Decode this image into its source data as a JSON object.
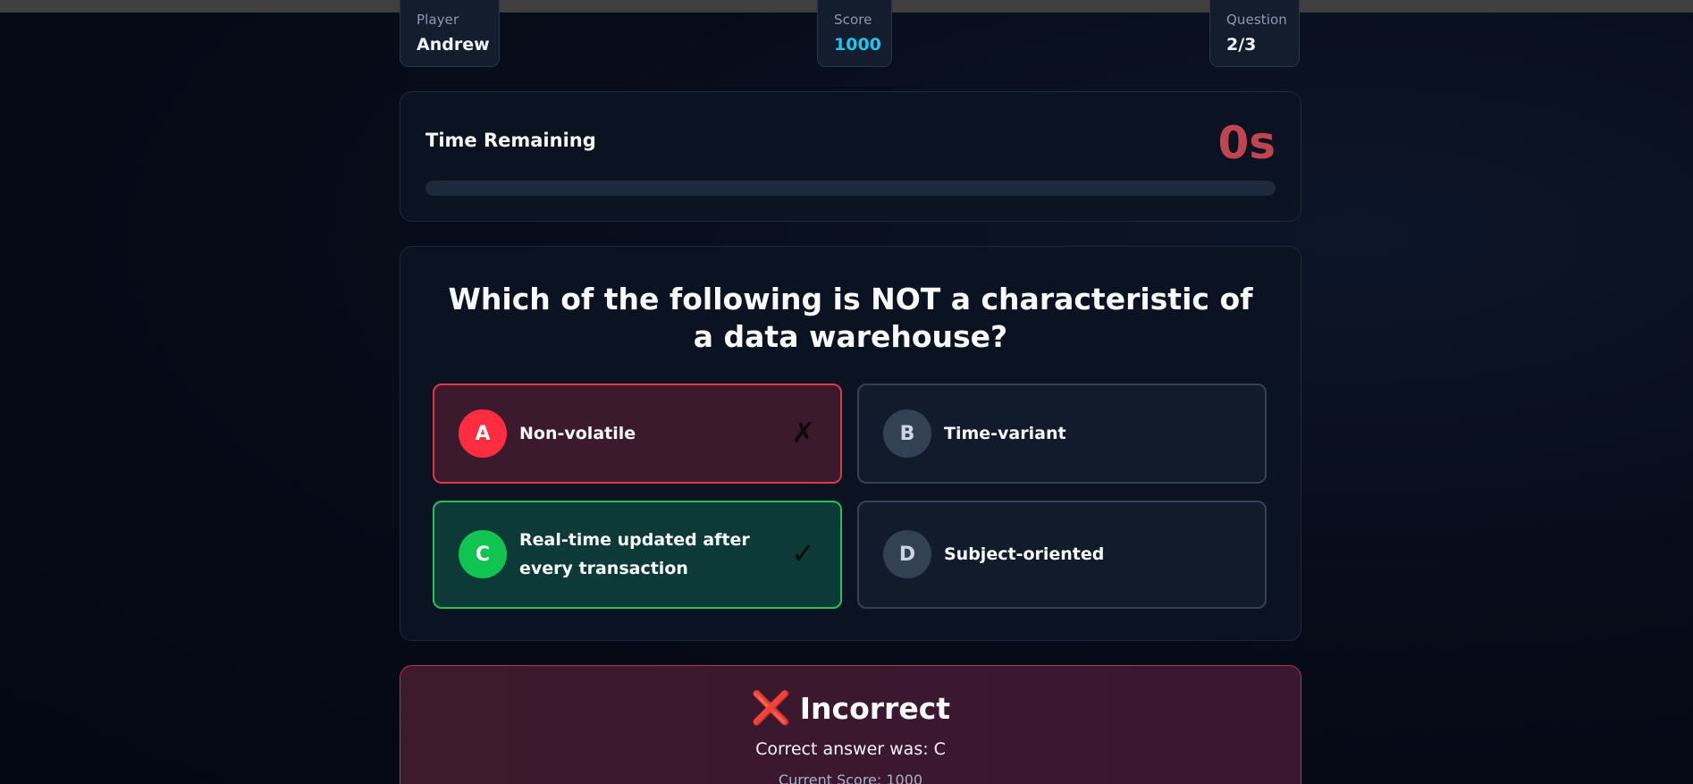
{
  "stats": {
    "player": {
      "label": "Player",
      "value": "Andrew"
    },
    "score": {
      "label": "Score",
      "value": "1000"
    },
    "question": {
      "label": "Question",
      "value": "2/3"
    }
  },
  "timer": {
    "title": "Time Remaining",
    "value": "0s",
    "progress_fraction": 0
  },
  "question": {
    "text": "Which of the following is NOT a characteristic of a data warehouse?",
    "options": [
      {
        "letter": "A",
        "text": "Non-volatile",
        "state": "incorrect-selected",
        "mark": "✗"
      },
      {
        "letter": "B",
        "text": "Time-variant",
        "state": "neutral",
        "mark": ""
      },
      {
        "letter": "C",
        "text": "Real-time updated after every transaction",
        "state": "correct",
        "mark": "✓"
      },
      {
        "letter": "D",
        "text": "Subject-oriented",
        "state": "neutral",
        "mark": ""
      }
    ]
  },
  "result": {
    "icon": "cross-mark-icon",
    "icon_glyph": "❌",
    "title": "Incorrect",
    "answer_text": "Correct answer was: C",
    "score_text": "Current Score: 1000"
  },
  "colors": {
    "accent": "#22c4ee",
    "incorrect": "#ff2d3f",
    "correct": "#10c44f",
    "timer": "#c0454e"
  }
}
